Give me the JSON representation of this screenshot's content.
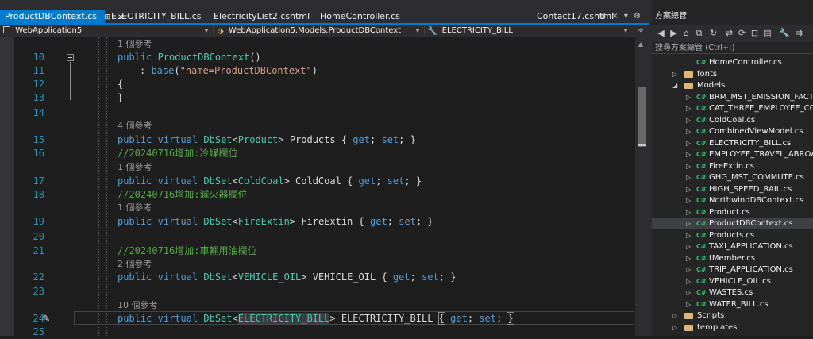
{
  "tabs": {
    "items": [
      "ProductDBContext.cs",
      "ELECTRICITY_BILL.cs",
      "ElectricityList2.cshtml",
      "HomeController.cs",
      "Contact17.cshtml"
    ],
    "active_pin": "⊞",
    "close": "×"
  },
  "nav": {
    "project": "WebApplication5",
    "class": "WebApplication5.Models.ProductDBContext",
    "member": "ELECTRICITY_BILL"
  },
  "editor": {
    "lines": [
      {
        "num": "",
        "ref": "1 個參考"
      },
      {
        "num": "10",
        "code": "public ProductDBContext()"
      },
      {
        "num": "11",
        "code": "    : base(\"name=ProductDBContext\")"
      },
      {
        "num": "12",
        "code": "{"
      },
      {
        "num": "13",
        "code": "}"
      },
      {
        "num": "14",
        "code": ""
      },
      {
        "num": "",
        "ref": "4 個參考"
      },
      {
        "num": "15",
        "code": "public virtual DbSet<Product> Products { get; set; }"
      },
      {
        "num": "16",
        "code": "//20240716增加:冷媒欄位"
      },
      {
        "num": "",
        "ref": "1 個參考"
      },
      {
        "num": "17",
        "code": "public virtual DbSet<ColdCoal> ColdCoal { get; set; }"
      },
      {
        "num": "18",
        "code": "//20240716增加:滅火器欄位"
      },
      {
        "num": "",
        "ref": "1 個參考"
      },
      {
        "num": "19",
        "code": "public virtual DbSet<FireExtin> FireExtin { get; set; }"
      },
      {
        "num": "20",
        "code": ""
      },
      {
        "num": "21",
        "code": "//20240716增加:車輛用油欄位"
      },
      {
        "num": "",
        "ref": "2 個參考"
      },
      {
        "num": "22",
        "code": "public virtual DbSet<VEHICLE_OIL> VEHICLE_OIL { get; set; }"
      },
      {
        "num": "23",
        "code": ""
      },
      {
        "num": "",
        "ref": "10 個參考"
      },
      {
        "num": "24",
        "code": "public virtual DbSet<ELECTRICITY_BILL> ELECTRICITY_BILL { get; set; }"
      },
      {
        "num": "25",
        "code": ""
      }
    ],
    "tokens": {
      "l10_kw": "public",
      "l10_name": "ProductDBContext",
      "l10_paren": "()",
      "l11_colon": ": ",
      "l11_base": "base",
      "l11_open": "(",
      "l11_str": "\"name=ProductDBContext\"",
      "l11_close": ")",
      "pub": "public",
      "virt": "virtual",
      "dbset": "DbSet",
      "lt": "<",
      "gt": ">",
      "get": "get",
      "set": "set",
      "semi": ";",
      "obr": "{",
      "cbr": "}",
      "t_product": "Product",
      "n_products": "Products",
      "t_cold": "ColdCoal",
      "n_cold": "ColdCoal",
      "t_fire": "FireExtin",
      "n_fire": "FireExtin",
      "t_veh": "VEHICLE_OIL",
      "n_veh": "VEHICLE_OIL",
      "t_elec": "ELECTRICITY_BILL",
      "n_elec": "ELECTRICITY_BILL"
    }
  },
  "solution_explorer": {
    "title": "方案總管",
    "search_placeholder": "搜尋方案總管 (Ctrl+;)",
    "cs_badge": "C#",
    "items": [
      {
        "label": "HomeController.cs",
        "type": "cs"
      },
      {
        "label": "fonts",
        "type": "folder"
      },
      {
        "label": "Models",
        "type": "folder-open"
      },
      {
        "label": "BRM_MST_EMISSION_FACTOR.cs",
        "type": "cs"
      },
      {
        "label": "CAT_THREE_EMPLOYEE_COMMUTE.cs",
        "type": "cs"
      },
      {
        "label": "ColdCoal.cs",
        "type": "cs"
      },
      {
        "label": "CombinedViewModel.cs",
        "type": "cs"
      },
      {
        "label": "ELECTRICITY_BILL.cs",
        "type": "cs"
      },
      {
        "label": "EMPLOYEE_TRAVEL_ABROAD.cs",
        "type": "cs"
      },
      {
        "label": "FireExtin.cs",
        "type": "cs"
      },
      {
        "label": "GHG_MST_COMMUTE.cs",
        "type": "cs"
      },
      {
        "label": "HIGH_SPEED_RAIL.cs",
        "type": "cs"
      },
      {
        "label": "NorthwindDBContext.cs",
        "type": "cs"
      },
      {
        "label": "Product.cs",
        "type": "cs"
      },
      {
        "label": "ProductDBContext.cs",
        "type": "cs",
        "selected": true
      },
      {
        "label": "Products.cs",
        "type": "cs"
      },
      {
        "label": "TAXI_APPLICATION.cs",
        "type": "cs"
      },
      {
        "label": "tMember.cs",
        "type": "cs"
      },
      {
        "label": "TRIP_APPLICATION.cs",
        "type": "cs"
      },
      {
        "label": "VEHICLE_OIL.cs",
        "type": "cs"
      },
      {
        "label": "WASTES.cs",
        "type": "cs"
      },
      {
        "label": "WATER_BILL.cs",
        "type": "cs"
      },
      {
        "label": "Scripts",
        "type": "folder"
      },
      {
        "label": "templates",
        "type": "folder"
      }
    ]
  },
  "colors": {
    "accent": "#007acc",
    "keyword": "#569cd6",
    "type": "#4ec9b0",
    "string": "#d69d85",
    "comment": "#57a64a",
    "line_number": "#2b91af"
  }
}
